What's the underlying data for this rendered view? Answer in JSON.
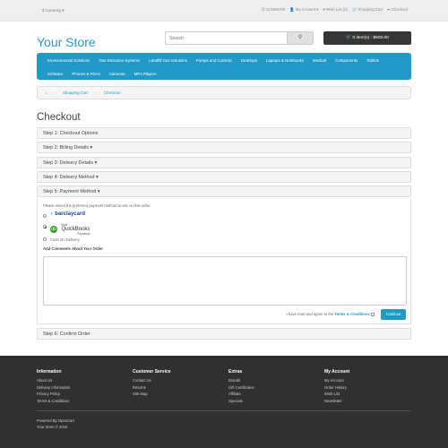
{
  "topbar": {
    "currency": "$ Currency ▾",
    "phone": "123456789",
    "account": "My Account ▾",
    "wishlist": "Wish List (0)",
    "cart": "Shopping Cart",
    "checkout": "Checkout"
  },
  "logo": "Your Store",
  "search": {
    "placeholder": "Search",
    "button_icon": "search-icon"
  },
  "cart_button": "0 item(s) - $600.00",
  "menu": {
    "row1": [
      "Environmental Solutions",
      "Gas Detection Systems",
      "LandfIll Gas Solutions",
      "Pumps and Controls",
      "Desktops",
      "Laptops & Notebooks",
      "Medical",
      "Components",
      "Tablets"
    ],
    "row2": [
      "Software",
      "Phones & PDAs",
      "Cameras",
      "MP3 Players"
    ]
  },
  "breadcrumb": {
    "home_icon": "home-icon",
    "items": [
      "Shopping Cart",
      "Checkout"
    ]
  },
  "page_title": "Checkout",
  "steps": [
    "Step 1: Checkout Options",
    "Step 2: Billing Details ▾",
    "Step 3: Delivery Details ▾",
    "Step 4: Delivery Method ▾",
    "Step 5: Payment Method ▾",
    "Step 6: Confirm Order"
  ],
  "payment": {
    "instruction": "Please select the preferred payment method to use on this order.",
    "methods": [
      {
        "label": "barclaycard",
        "checked": false
      },
      {
        "label": "QuickBooks",
        "sublabel": "Payments",
        "prefix": "intuit",
        "checked": true
      },
      {
        "label": "Cash On Delivery",
        "checked": false
      }
    ],
    "comments_label": "Add Comments About Your Order",
    "agree_text": "I have read and agree to the",
    "agree_link": "Terms & Conditions",
    "continue_label": "Continue"
  },
  "footer": {
    "information": {
      "title": "Information",
      "items": [
        "About Us",
        "Delivery Information",
        "Privacy Policy",
        "Terms & Conditions"
      ]
    },
    "customer_service": {
      "title": "Customer Service",
      "items": [
        "Contact Us",
        "Returns",
        "Site Map"
      ]
    },
    "extras": {
      "title": "Extras",
      "items": [
        "Brands",
        "Gift Certificates",
        "Affiliate",
        "Specials"
      ]
    },
    "my_account": {
      "title": "My Account",
      "items": [
        "My Account",
        "Order History",
        "Wish List",
        "Newsletter"
      ]
    },
    "powered_by": "Powered By OpenCart",
    "copyright": "Your Store © 2019"
  },
  "colors": {
    "accent": "#229ac8",
    "footer_bg": "#303030",
    "topbar_bg": "#eeeeee",
    "cart_btn": "#363636"
  }
}
